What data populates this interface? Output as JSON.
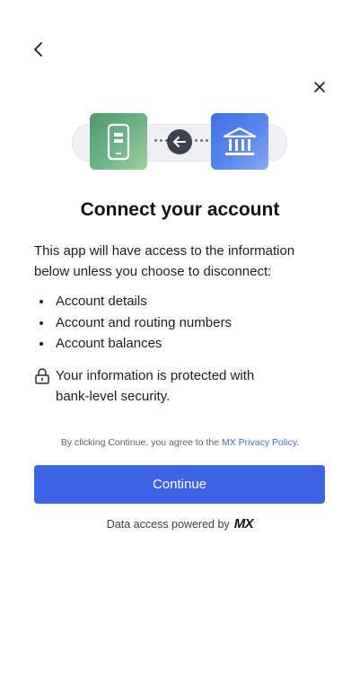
{
  "nav": {
    "back_icon": "chevron-left-icon",
    "close_icon": "close-icon"
  },
  "hero": {
    "phone_icon": "phone-icon",
    "arrow_icon": "arrow-left-icon",
    "bank_icon": "bank-icon",
    "colors": {
      "phone_tile": "#5fa876",
      "bank_tile": "#4a7ae9",
      "arrow_circle": "#3b4250"
    }
  },
  "title": "Connect your account",
  "intro": "This app will have access to the information below unless you choose to disconnect:",
  "access_items": [
    "Account details",
    "Account and routing numbers",
    "Account balances"
  ],
  "security": {
    "icon": "lock-icon",
    "text": "Your information is protected with bank-level security."
  },
  "consent": {
    "prefix": "By clicking Continue, you agree to the ",
    "link_label": "MX Privacy Policy",
    "suffix": "."
  },
  "continue_button": {
    "label": "Continue",
    "color": "#3d63e8"
  },
  "footer": {
    "prefix": "Data access powered by",
    "brand": "MX"
  }
}
